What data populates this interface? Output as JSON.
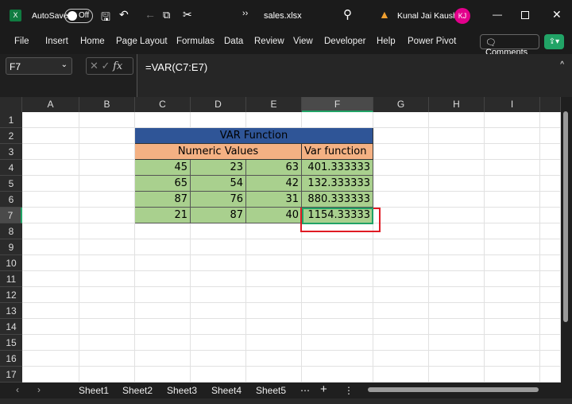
{
  "titlebar": {
    "app_icon": "excel-icon",
    "autosave_label": "AutoSave",
    "autosave_state": "Off",
    "filename": "sales.xlsx",
    "user_name": "Kunal Jai Kaushik",
    "user_initials": "KJ",
    "warning_icon": "warning-icon"
  },
  "ribbon": {
    "tabs": [
      "File",
      "Insert",
      "Home",
      "Page Layout",
      "Formulas",
      "Data",
      "Review",
      "View",
      "Developer",
      "Help",
      "Power Pivot"
    ],
    "comments_label": "Comments",
    "share_icon": "share-icon"
  },
  "formula_bar": {
    "name_box": "F7",
    "fx": "fx",
    "formula": "=VAR(C7:E7)"
  },
  "columns": [
    "A",
    "B",
    "C",
    "D",
    "E",
    "F",
    "G",
    "H",
    "I"
  ],
  "rows": [
    "1",
    "2",
    "3",
    "4",
    "5",
    "6",
    "7",
    "8",
    "9",
    "10",
    "11",
    "12",
    "13",
    "14",
    "15",
    "16",
    "17"
  ],
  "table": {
    "title": "VAR Function",
    "header_values": "Numeric Values",
    "header_var": "Var function",
    "data": [
      [
        "45",
        "23",
        "63",
        "401.333333"
      ],
      [
        "65",
        "54",
        "42",
        "132.333333"
      ],
      [
        "87",
        "76",
        "31",
        "880.333333"
      ],
      [
        "21",
        "87",
        "40",
        "1154.33333"
      ]
    ]
  },
  "colors": {
    "title_fill": "#2f5597",
    "header_fill": "#f4b183",
    "data_fill": "#a9d08e",
    "selection": "#e01b24",
    "accent": "#21a366"
  },
  "sheets": [
    "Sheet1",
    "Sheet2",
    "Sheet3",
    "Sheet4",
    "Sheet5"
  ]
}
